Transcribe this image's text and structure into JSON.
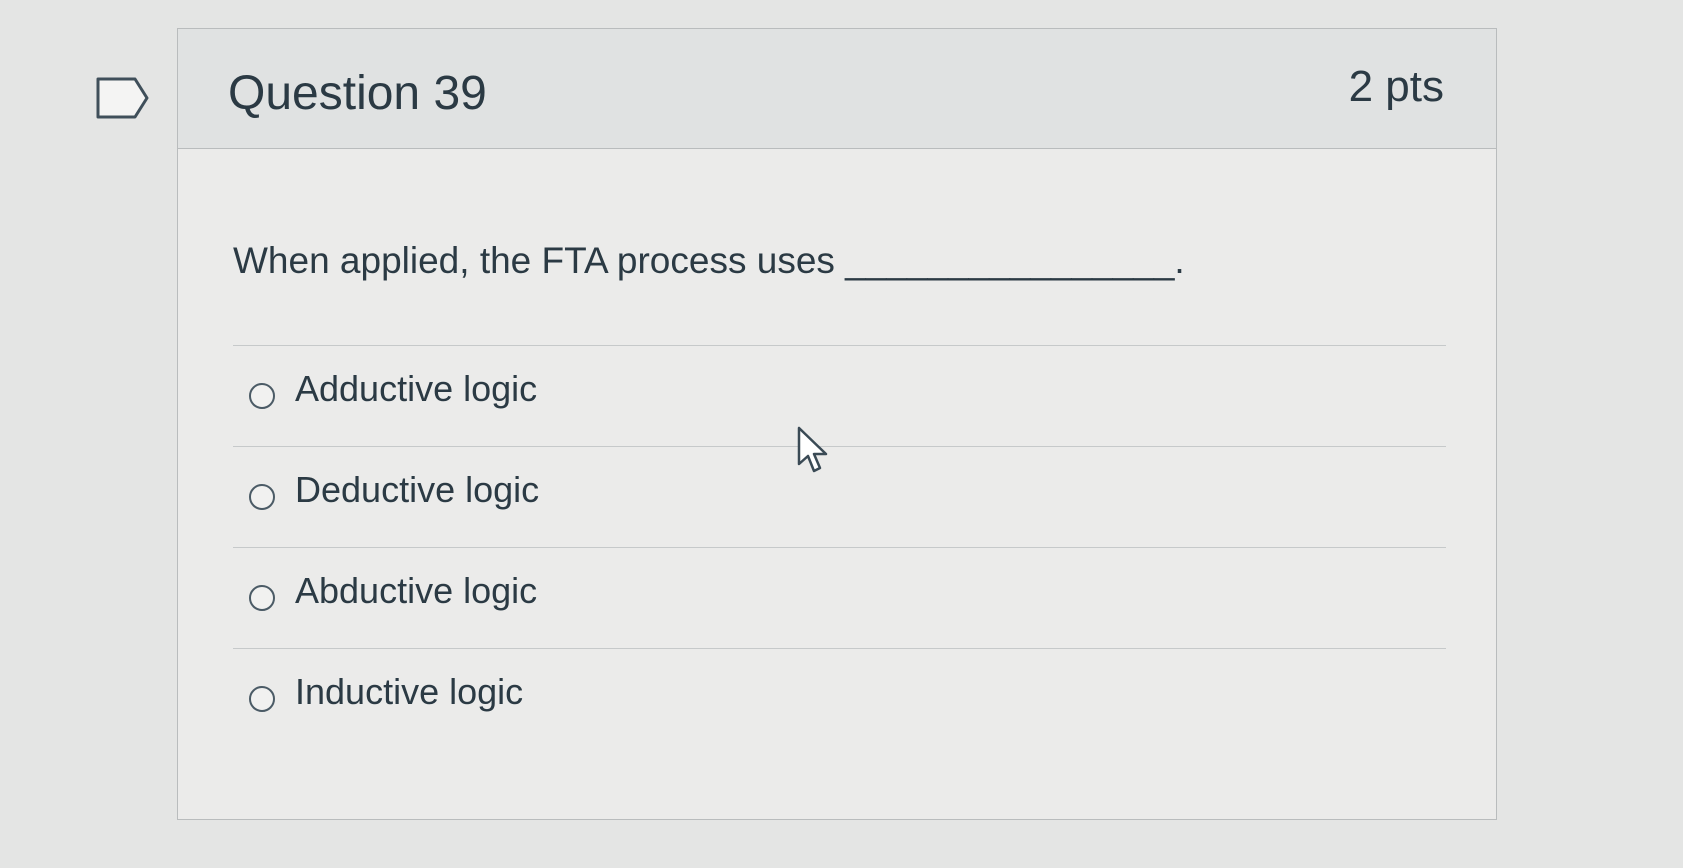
{
  "question": {
    "title": "Question 39",
    "points": "2 pts",
    "text": "When applied, the FTA process uses ________________.",
    "answers": [
      {
        "label": "Adductive logic",
        "selected": false
      },
      {
        "label": "Deductive logic",
        "selected": false
      },
      {
        "label": "Abductive logic",
        "selected": false
      },
      {
        "label": "Inductive logic",
        "selected": false
      }
    ]
  },
  "icons": {
    "flag": "flag-question-icon",
    "cursor": "mouse-pointer-icon",
    "radio": "radio-unchecked-icon"
  },
  "colors": {
    "background": "#e4e5e4",
    "card": "#ebebea",
    "header": "#e0e2e2",
    "text": "#2b3a44",
    "border": "#b9bcbd"
  }
}
